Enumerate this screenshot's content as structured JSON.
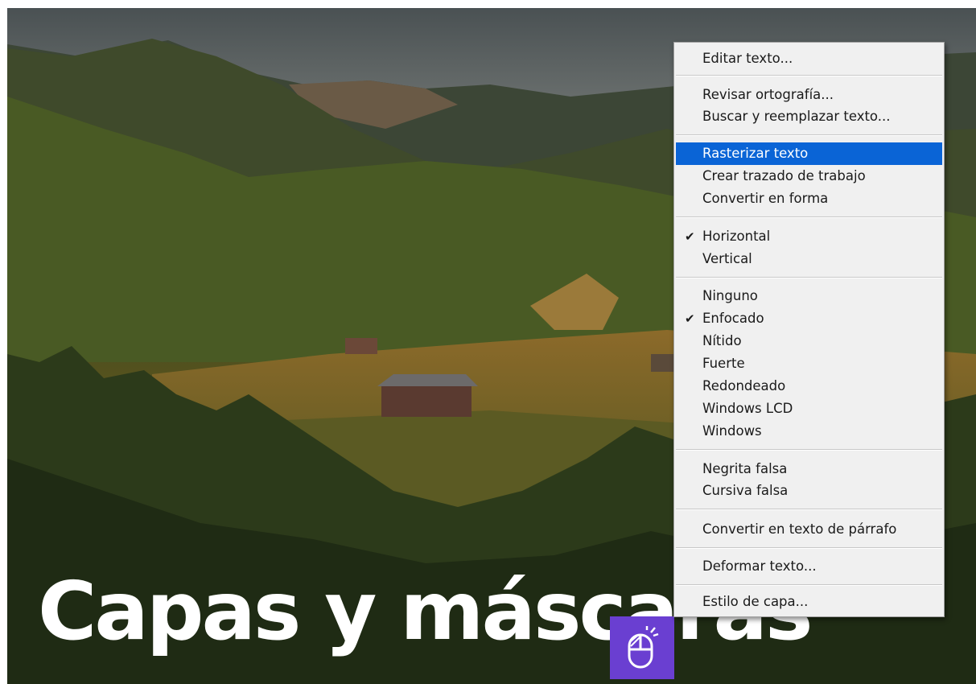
{
  "canvas": {
    "overlay_text": "Capas y máscaras"
  },
  "badge": {
    "icon": "mouse-click-icon",
    "color": "#6a3fd1"
  },
  "context_menu": {
    "highlight_color": "#0a64d6",
    "items": {
      "editar_texto": "Editar texto...",
      "revisar_ortografia": "Revisar ortografía...",
      "buscar_reemplazar": "Buscar y reemplazar texto...",
      "rasterizar_texto": "Rasterizar texto",
      "crear_trazado": "Crear trazado de trabajo",
      "convertir_forma": "Convertir en forma",
      "horizontal": "Horizontal",
      "vertical": "Vertical",
      "ninguno": "Ninguno",
      "enfocado": "Enfocado",
      "nitido": "Nítido",
      "fuerte": "Fuerte",
      "redondeado": "Redondeado",
      "windows_lcd": "Windows LCD",
      "windows": "Windows",
      "negrita_falsa": "Negrita falsa",
      "cursiva_falsa": "Cursiva falsa",
      "convertir_parrafo": "Convertir en texto de párrafo",
      "deformar_texto": "Deformar texto...",
      "estilo_capa": "Estilo de capa..."
    },
    "checked_glyph": "✔",
    "highlighted_item": "Rasterizar texto",
    "checked_items": [
      "Horizontal",
      "Enfocado"
    ]
  }
}
